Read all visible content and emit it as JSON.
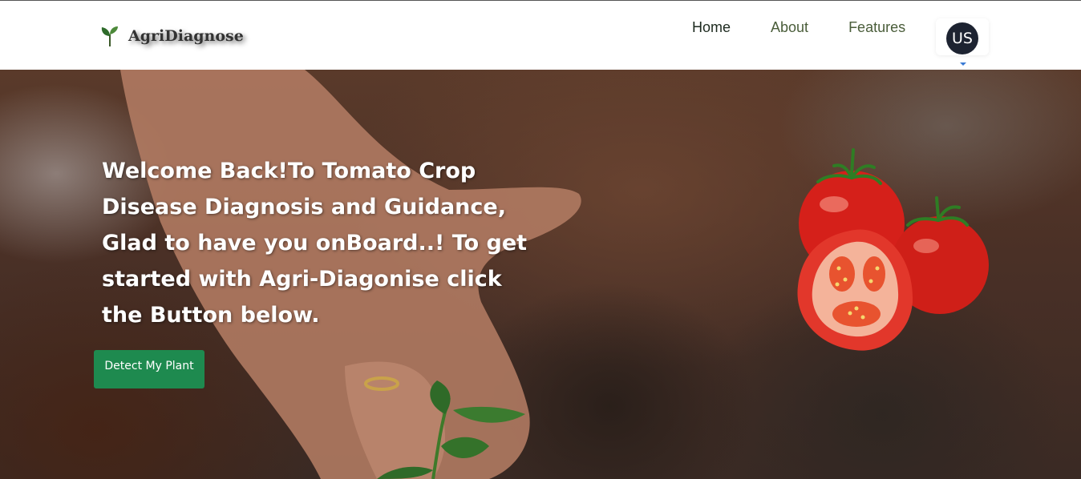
{
  "brand": {
    "name": "AgriDiagnose",
    "logo_icon": "leaf-sprout-icon"
  },
  "nav": {
    "links": [
      {
        "label": "Home",
        "active": true
      },
      {
        "label": "About",
        "active": false
      },
      {
        "label": "Features",
        "active": false
      }
    ],
    "avatar_initials": "US"
  },
  "hero": {
    "heading": "Welcome Back!To Tomato Crop Disease Diagnosis and Guidance, Glad to have you onBoard..! To get started with Agri-Diagonise click the Button below.",
    "cta_label": "Detect My Plant"
  },
  "colors": {
    "cta_background": "#1e8a4f",
    "avatar_background": "#1d2331",
    "nav_link": "#4a5d3a"
  }
}
